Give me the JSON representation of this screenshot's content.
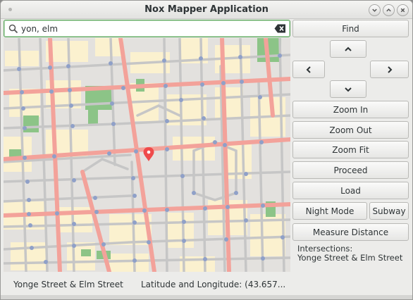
{
  "window": {
    "title": "Nox Mapper Application"
  },
  "search": {
    "value": "yon, elm"
  },
  "buttons": {
    "find": "Find",
    "zoom_in": "Zoom In",
    "zoom_out": "Zoom Out",
    "zoom_fit": "Zoom Fit",
    "proceed": "Proceed",
    "load": "Load",
    "night_mode": "Night Mode",
    "subway": "Subway",
    "measure_distance": "Measure Distance"
  },
  "info_panel": {
    "heading": "Intersections:",
    "value": "Yonge Street & Elm Street"
  },
  "status_bar": {
    "location": "Yonge Street & Elm Street",
    "coordinates": "Latitude and Longitude: (43.657..."
  },
  "map": {
    "colors": {
      "background": "#e3e1de",
      "block": "#fbf1cf",
      "park": "#8cc487",
      "major_road": "#f3a29a",
      "minor_road": "#c6c6c6",
      "node": "#8fa0c8",
      "marker": "#ef4b4b"
    },
    "marker_icon": "map-pin-icon"
  },
  "icons": {
    "search": "search-icon",
    "clear": "clear-text-icon",
    "pan_up": "chevron-up-icon",
    "pan_left": "chevron-left-icon",
    "pan_right": "chevron-right-icon",
    "pan_down": "chevron-down-icon",
    "minimize": "minimize-icon",
    "maximize": "maximize-icon",
    "close": "close-icon"
  }
}
